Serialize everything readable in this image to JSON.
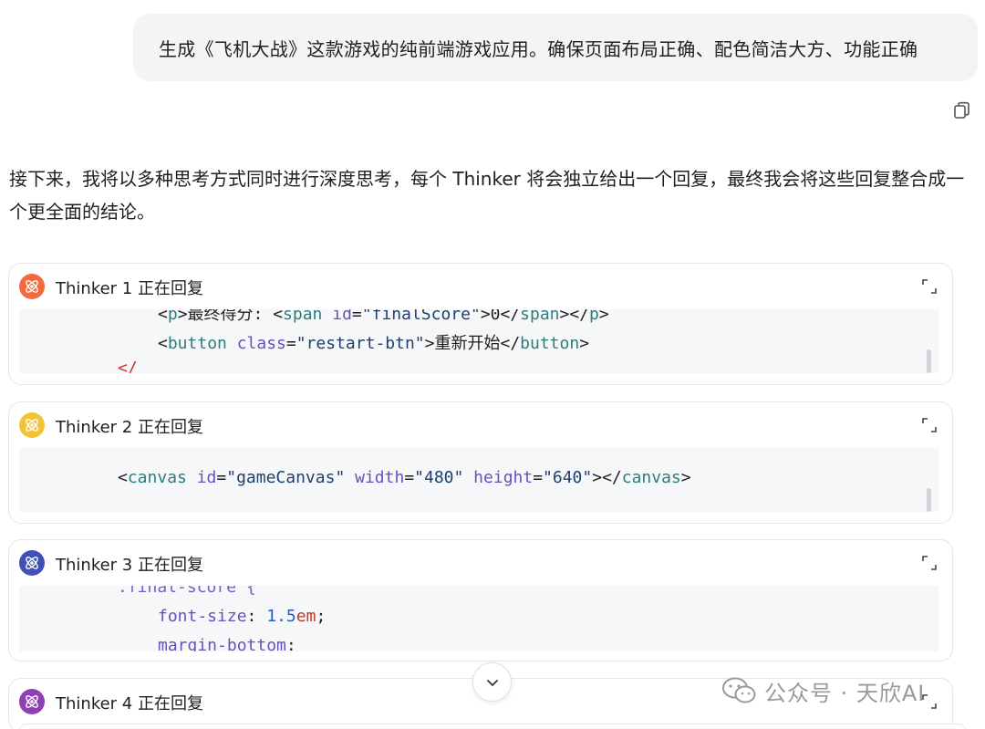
{
  "user_message": "生成《飞机大战》这款游戏的纯前端游戏应用。确保页面布局正确、配色简洁大方、功能正确",
  "intro_text": "接下来，我将以多种思考方式同时进行深度思考，每个 Thinker 将会独立给出一个回复，最终我会将这些回复整合成一个更全面的结论。",
  "thinkers": [
    {
      "title": "Thinker 1 正在回复",
      "avatar_color": "#f26a3d",
      "code": {
        "l1": {
          "t1": "<",
          "t2": "p",
          "t3": ">最终得分: <",
          "t4": "span",
          "t5": " id",
          "t6": "=",
          "t7": "\"finalScore\"",
          "t8": ">0</",
          "t9": "span",
          "t10": "></",
          "t11": "p",
          "t12": ">"
        },
        "l2": {
          "t1": "<",
          "t2": "button",
          "t3": " class",
          "t4": "=",
          "t5": "\"restart-btn\"",
          "t6": ">重新开始</",
          "t7": "button",
          "t8": ">"
        },
        "l3": {
          "t1": "</"
        }
      }
    },
    {
      "title": "Thinker 2 正在回复",
      "avatar_color": "#f4c237",
      "code": {
        "l1": {
          "t1": "<",
          "t2": "canvas",
          "t3": " id",
          "t4": "=",
          "t5": "\"gameCanvas\"",
          "t6": " width",
          "t7": "=",
          "t8": "\"480\"",
          "t9": " height",
          "t10": "=",
          "t11": "\"640\"",
          "t12": "></",
          "t13": "canvas",
          "t14": ">"
        }
      }
    },
    {
      "title": "Thinker 3 正在回复",
      "avatar_color": "#3f51b5",
      "code": {
        "l1": {
          "t1": ".final-score {"
        },
        "l2": {
          "t1": "font-size",
          "t2": ": ",
          "t3": "1.5",
          "t4": "em",
          "t5": ";"
        },
        "l3": {
          "t1": "margin-bottom",
          "t2": ":"
        }
      }
    },
    {
      "title": "Thinker 4 正在回复",
      "avatar_color": "#8e3fb5"
    }
  ],
  "watermark": "公众号 · 天欣AI",
  "icons": {
    "copy": "copy-icon",
    "expand": "expand-icon",
    "avatar": "atom-icon",
    "scroll_down": "chevron-down-icon",
    "watermark_logo": "wechat-icon"
  }
}
